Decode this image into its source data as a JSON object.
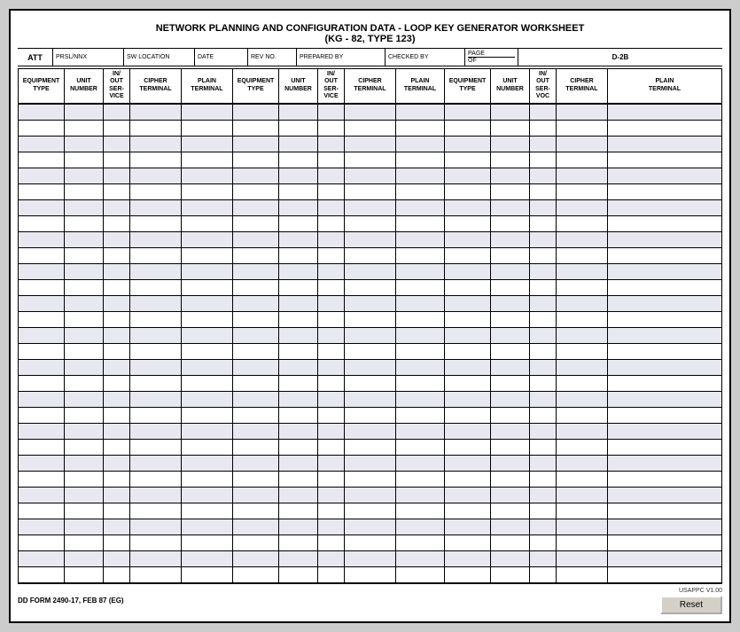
{
  "title_line1": "NETWORK PLANNING AND CONFIGURATION DATA - LOOP KEY GENERATOR WORKSHEET",
  "title_line2": "(KG - 82, TYPE 123)",
  "header": {
    "att": "ATT",
    "prslnnx": "PRSL/NNX",
    "sw_location": "SW LOCATION",
    "date": "DATE",
    "rev_no": "REV NO.",
    "prepared_by": "PREPARED BY",
    "checked_by": "CHECKED BY",
    "page": "PAGE",
    "of": "OF",
    "d2b": "D-2B"
  },
  "col_headers": [
    {
      "id": "eq-type-1",
      "label": "EQUIPMENT\nTYPE"
    },
    {
      "id": "unit-num-1",
      "label": "UNIT\nNUMBER"
    },
    {
      "id": "in-out-1",
      "label": "IN/\nOUT\nSER-\nVICE"
    },
    {
      "id": "cipher-1",
      "label": "CIPHER\nTERMINAL"
    },
    {
      "id": "plain-1",
      "label": "PLAIN\nTERMINAL"
    },
    {
      "id": "eq-type-2",
      "label": "EQUIPMENT\nTYPE"
    },
    {
      "id": "unit-num-2",
      "label": "UNIT\nNUMBER"
    },
    {
      "id": "in-out-2",
      "label": "IN/\nOUT\nSER-\nVICE"
    },
    {
      "id": "cipher-2",
      "label": "CIPHER\nTERMINAL"
    },
    {
      "id": "plain-2",
      "label": "PLAIN\nTERMINAL"
    },
    {
      "id": "eq-type-3",
      "label": "EQUIPMENT\nTYPE"
    },
    {
      "id": "unit-num-3",
      "label": "UNIT\nNUMBER"
    },
    {
      "id": "in-out-3",
      "label": "IN/\nOUT\nSER-\nVOC"
    },
    {
      "id": "cipher-3",
      "label": "CIPHER\nTERMINAL"
    },
    {
      "id": "plain-3",
      "label": "PLAIN\nTERMINAL"
    }
  ],
  "num_data_rows": 30,
  "footer": {
    "form_id": "DD FORM 2490-17, FEB 87 (EG)",
    "usappc": "USAPPC V1.00",
    "reset_button": "Reset"
  }
}
